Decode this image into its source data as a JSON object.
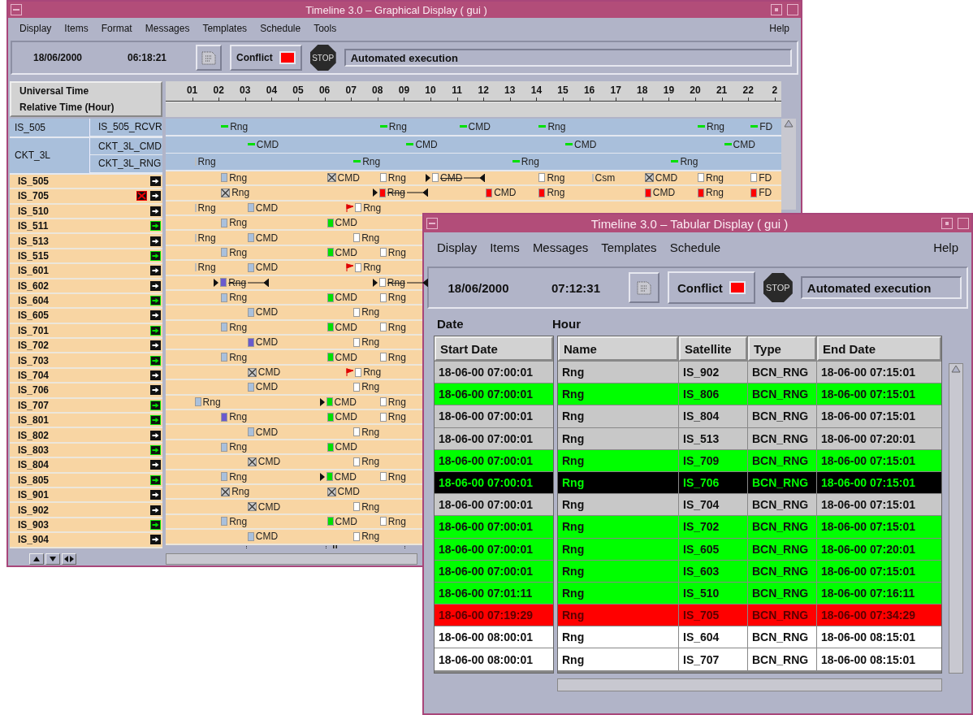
{
  "graphical": {
    "title": "Timeline 3.0 – Graphical Display ( gui )",
    "menu": [
      "Display",
      "Items",
      "Format",
      "Messages",
      "Templates",
      "Schedule",
      "Tools"
    ],
    "help": "Help",
    "date": "18/06/2000",
    "time": "06:18:21",
    "conflict_label": "Conflict",
    "conflict": true,
    "stop_label": "STOP",
    "status": "Automated execution",
    "header": [
      "Universal Time",
      "Relative Time (Hour)"
    ],
    "hours": [
      "01",
      "02",
      "03",
      "04",
      "05",
      "06",
      "07",
      "08",
      "09",
      "10",
      "11",
      "12",
      "13",
      "14",
      "15",
      "16",
      "17",
      "18",
      "19",
      "20",
      "21",
      "22",
      "2"
    ],
    "groups": [
      {
        "name": "IS_505",
        "rows": [
          {
            "name": "IS_505_RCVR",
            "items": [
              {
                "kind": "gap"
              },
              {
                "kind": "gap"
              },
              {
                "kind": "dash",
                "label": "Rng"
              },
              {
                "kind": "gap"
              },
              {
                "kind": "gap"
              },
              {
                "kind": "gap"
              },
              {
                "kind": "gap"
              },
              {
                "kind": "gap"
              },
              {
                "kind": "dash",
                "label": "Rng"
              },
              {
                "kind": "gap"
              },
              {
                "kind": "gap"
              },
              {
                "kind": "dash",
                "label": "CMD"
              },
              {
                "kind": "gap"
              },
              {
                "kind": "gap"
              },
              {
                "kind": "dash",
                "label": "Rng"
              },
              {
                "kind": "gap"
              },
              {
                "kind": "gap"
              },
              {
                "kind": "gap"
              },
              {
                "kind": "gap"
              },
              {
                "kind": "gap"
              },
              {
                "kind": "dash",
                "label": "Rng"
              },
              {
                "kind": "gap"
              },
              {
                "kind": "dash",
                "label": "FD"
              }
            ]
          }
        ]
      },
      {
        "name": "CKT_3L",
        "rows": [
          {
            "name": "CKT_3L_CMD",
            "items": [
              {
                "kind": "gap"
              },
              {
                "kind": "gap"
              },
              {
                "kind": "gap"
              },
              {
                "kind": "dash",
                "label": "CMD"
              },
              {
                "kind": "gap"
              },
              {
                "kind": "gap"
              },
              {
                "kind": "gap"
              },
              {
                "kind": "gap"
              },
              {
                "kind": "gap"
              },
              {
                "kind": "dash",
                "label": "CMD"
              },
              {
                "kind": "gap"
              },
              {
                "kind": "gap"
              },
              {
                "kind": "gap"
              },
              {
                "kind": "gap"
              },
              {
                "kind": "gap"
              },
              {
                "kind": "dash",
                "label": "CMD"
              },
              {
                "kind": "gap"
              },
              {
                "kind": "gap"
              },
              {
                "kind": "gap"
              },
              {
                "kind": "gap"
              },
              {
                "kind": "gap"
              },
              {
                "kind": "dash",
                "label": "CMD"
              }
            ]
          },
          {
            "name": "CKT_3L_RNG",
            "items": [
              {
                "kind": "gap"
              },
              {
                "kind": "tick",
                "label": "Rng"
              },
              {
                "kind": "gap"
              },
              {
                "kind": "gap"
              },
              {
                "kind": "gap"
              },
              {
                "kind": "gap"
              },
              {
                "kind": "gap"
              },
              {
                "kind": "dash",
                "label": "Rng"
              },
              {
                "kind": "gap"
              },
              {
                "kind": "gap"
              },
              {
                "kind": "gap"
              },
              {
                "kind": "gap"
              },
              {
                "kind": "gap"
              },
              {
                "kind": "dash",
                "label": "Rng"
              },
              {
                "kind": "gap"
              },
              {
                "kind": "gap"
              },
              {
                "kind": "gap"
              },
              {
                "kind": "gap"
              },
              {
                "kind": "gap"
              },
              {
                "kind": "dash",
                "label": "Rng"
              }
            ]
          }
        ]
      }
    ],
    "rows": [
      {
        "name": "IS_505",
        "active": false,
        "error": false,
        "items": [
          {
            "kind": "gap"
          },
          {
            "kind": "gap"
          },
          {
            "kind": "lightblue",
            "label": "Rng"
          },
          {
            "kind": "gap"
          },
          {
            "kind": "gap"
          },
          {
            "kind": "gap"
          },
          {
            "kind": "cross",
            "label": "CMD"
          },
          {
            "kind": "gap"
          },
          {
            "kind": "white",
            "label": "Rng"
          },
          {
            "kind": "gap"
          },
          {
            "kind": "whitebracket",
            "label": "CMD"
          },
          {
            "kind": "gap"
          },
          {
            "kind": "gap"
          },
          {
            "kind": "gap"
          },
          {
            "kind": "white",
            "label": "Rng"
          },
          {
            "kind": "gap"
          },
          {
            "kind": "tick",
            "label": "Csm"
          },
          {
            "kind": "gap"
          },
          {
            "kind": "cross",
            "label": "CMD"
          },
          {
            "kind": "gap"
          },
          {
            "kind": "white",
            "label": "Rng"
          },
          {
            "kind": "gap"
          },
          {
            "kind": "white",
            "label": "FD"
          }
        ]
      },
      {
        "name": "IS_705",
        "active": false,
        "error": true,
        "items": [
          {
            "kind": "gap"
          },
          {
            "kind": "gap"
          },
          {
            "kind": "cross",
            "label": "Rng"
          },
          {
            "kind": "gap"
          },
          {
            "kind": "gap"
          },
          {
            "kind": "gap"
          },
          {
            "kind": "gap"
          },
          {
            "kind": "gap"
          },
          {
            "kind": "redbracket",
            "label": "Rng"
          },
          {
            "kind": "gap"
          },
          {
            "kind": "gap"
          },
          {
            "kind": "gap"
          },
          {
            "kind": "red",
            "label": "CMD"
          },
          {
            "kind": "gap"
          },
          {
            "kind": "red",
            "label": "Rng"
          },
          {
            "kind": "gap"
          },
          {
            "kind": "gap"
          },
          {
            "kind": "gap"
          },
          {
            "kind": "red",
            "label": "CMD"
          },
          {
            "kind": "gap"
          },
          {
            "kind": "red",
            "label": "Rng"
          },
          {
            "kind": "gap"
          },
          {
            "kind": "red",
            "label": "FD"
          }
        ]
      },
      {
        "name": "IS_510",
        "active": false,
        "error": false,
        "items": [
          {
            "kind": "gap"
          },
          {
            "kind": "tick",
            "label": "Rng"
          },
          {
            "kind": "gap"
          },
          {
            "kind": "lightblue",
            "label": "CMD"
          },
          {
            "kind": "gap"
          },
          {
            "kind": "gap"
          },
          {
            "kind": "gap"
          },
          {
            "kind": "whiteflag",
            "label": "Rng"
          }
        ]
      },
      {
        "name": "IS_511",
        "active": true,
        "error": false,
        "items": [
          {
            "kind": "gap"
          },
          {
            "kind": "gap"
          },
          {
            "kind": "lightblue",
            "label": "Rng"
          },
          {
            "kind": "gap"
          },
          {
            "kind": "gap"
          },
          {
            "kind": "gap"
          },
          {
            "kind": "green",
            "label": "CMD"
          }
        ]
      },
      {
        "name": "IS_513",
        "active": false,
        "error": false,
        "items": [
          {
            "kind": "gap"
          },
          {
            "kind": "tick",
            "label": "Rng"
          },
          {
            "kind": "gap"
          },
          {
            "kind": "lightblue",
            "label": "CMD"
          },
          {
            "kind": "gap"
          },
          {
            "kind": "gap"
          },
          {
            "kind": "gap"
          },
          {
            "kind": "white",
            "label": "Rng"
          }
        ]
      },
      {
        "name": "IS_515",
        "active": true,
        "error": false,
        "items": [
          {
            "kind": "gap"
          },
          {
            "kind": "gap"
          },
          {
            "kind": "lightblue",
            "label": "Rng"
          },
          {
            "kind": "gap"
          },
          {
            "kind": "gap"
          },
          {
            "kind": "gap"
          },
          {
            "kind": "green",
            "label": "CMD"
          },
          {
            "kind": "gap"
          },
          {
            "kind": "white",
            "label": "Rng"
          }
        ]
      },
      {
        "name": "IS_601",
        "active": false,
        "error": false,
        "items": [
          {
            "kind": "gap"
          },
          {
            "kind": "tick",
            "label": "Rng"
          },
          {
            "kind": "gap"
          },
          {
            "kind": "lightblue",
            "label": "CMD"
          },
          {
            "kind": "gap"
          },
          {
            "kind": "gap"
          },
          {
            "kind": "gap"
          },
          {
            "kind": "whiteflag",
            "label": "Rng"
          }
        ]
      },
      {
        "name": "IS_602",
        "active": false,
        "error": false,
        "items": [
          {
            "kind": "gap"
          },
          {
            "kind": "gap"
          },
          {
            "kind": "purplebracket",
            "label": "Rng"
          },
          {
            "kind": "gap"
          },
          {
            "kind": "gap"
          },
          {
            "kind": "gap"
          },
          {
            "kind": "gap"
          },
          {
            "kind": "gap"
          },
          {
            "kind": "whitebracket",
            "label": "Rng"
          }
        ]
      },
      {
        "name": "IS_604",
        "active": true,
        "error": false,
        "items": [
          {
            "kind": "gap"
          },
          {
            "kind": "gap"
          },
          {
            "kind": "lightblue",
            "label": "Rng"
          },
          {
            "kind": "gap"
          },
          {
            "kind": "gap"
          },
          {
            "kind": "gap"
          },
          {
            "kind": "green",
            "label": "CMD"
          },
          {
            "kind": "gap"
          },
          {
            "kind": "white",
            "label": "Rng"
          }
        ]
      },
      {
        "name": "IS_605",
        "active": false,
        "error": false,
        "items": [
          {
            "kind": "gap"
          },
          {
            "kind": "gap"
          },
          {
            "kind": "gap"
          },
          {
            "kind": "lightblue",
            "label": "CMD"
          },
          {
            "kind": "gap"
          },
          {
            "kind": "gap"
          },
          {
            "kind": "gap"
          },
          {
            "kind": "white",
            "label": "Rng"
          }
        ]
      },
      {
        "name": "IS_701",
        "active": true,
        "error": false,
        "items": [
          {
            "kind": "gap"
          },
          {
            "kind": "gap"
          },
          {
            "kind": "lightblue",
            "label": "Rng"
          },
          {
            "kind": "gap"
          },
          {
            "kind": "gap"
          },
          {
            "kind": "gap"
          },
          {
            "kind": "green",
            "label": "CMD"
          },
          {
            "kind": "gap"
          },
          {
            "kind": "white",
            "label": "Rng"
          }
        ]
      },
      {
        "name": "IS_702",
        "active": false,
        "error": false,
        "items": [
          {
            "kind": "gap"
          },
          {
            "kind": "gap"
          },
          {
            "kind": "gap"
          },
          {
            "kind": "purple",
            "label": "CMD"
          },
          {
            "kind": "gap"
          },
          {
            "kind": "gap"
          },
          {
            "kind": "gap"
          },
          {
            "kind": "white",
            "label": "Rng"
          }
        ]
      },
      {
        "name": "IS_703",
        "active": true,
        "error": false,
        "items": [
          {
            "kind": "gap"
          },
          {
            "kind": "gap"
          },
          {
            "kind": "lightblue",
            "label": "Rng"
          },
          {
            "kind": "gap"
          },
          {
            "kind": "gap"
          },
          {
            "kind": "gap"
          },
          {
            "kind": "green",
            "label": "CMD"
          },
          {
            "kind": "gap"
          },
          {
            "kind": "white",
            "label": "Rng"
          }
        ]
      },
      {
        "name": "IS_704",
        "active": false,
        "error": false,
        "items": [
          {
            "kind": "gap"
          },
          {
            "kind": "gap"
          },
          {
            "kind": "gap"
          },
          {
            "kind": "cross",
            "label": "CMD"
          },
          {
            "kind": "gap"
          },
          {
            "kind": "gap"
          },
          {
            "kind": "gap"
          },
          {
            "kind": "whiteflag",
            "label": "Rng"
          }
        ]
      },
      {
        "name": "IS_706",
        "active": false,
        "error": false,
        "items": [
          {
            "kind": "gap"
          },
          {
            "kind": "gap"
          },
          {
            "kind": "gap"
          },
          {
            "kind": "lightblue",
            "label": "CMD"
          },
          {
            "kind": "gap"
          },
          {
            "kind": "gap"
          },
          {
            "kind": "gap"
          },
          {
            "kind": "white",
            "label": "Rng"
          }
        ]
      },
      {
        "name": "IS_707",
        "active": true,
        "error": false,
        "items": [
          {
            "kind": "gap"
          },
          {
            "kind": "lightblue",
            "label": "Rng"
          },
          {
            "kind": "gap"
          },
          {
            "kind": "gap"
          },
          {
            "kind": "gap"
          },
          {
            "kind": "gap"
          },
          {
            "kind": "greenarrow",
            "label": "CMD"
          },
          {
            "kind": "gap"
          },
          {
            "kind": "white",
            "label": "Rng"
          }
        ]
      },
      {
        "name": "IS_801",
        "active": true,
        "error": false,
        "items": [
          {
            "kind": "gap"
          },
          {
            "kind": "gap"
          },
          {
            "kind": "purple",
            "label": "Rng"
          },
          {
            "kind": "gap"
          },
          {
            "kind": "gap"
          },
          {
            "kind": "gap"
          },
          {
            "kind": "green",
            "label": "CMD"
          },
          {
            "kind": "gap"
          },
          {
            "kind": "white",
            "label": "Rng"
          }
        ]
      },
      {
        "name": "IS_802",
        "active": false,
        "error": false,
        "items": [
          {
            "kind": "gap"
          },
          {
            "kind": "gap"
          },
          {
            "kind": "gap"
          },
          {
            "kind": "lightblue",
            "label": "CMD"
          },
          {
            "kind": "gap"
          },
          {
            "kind": "gap"
          },
          {
            "kind": "gap"
          },
          {
            "kind": "white",
            "label": "Rng"
          }
        ]
      },
      {
        "name": "IS_803",
        "active": true,
        "error": false,
        "items": [
          {
            "kind": "gap"
          },
          {
            "kind": "gap"
          },
          {
            "kind": "lightblue",
            "label": "Rng"
          },
          {
            "kind": "gap"
          },
          {
            "kind": "gap"
          },
          {
            "kind": "gap"
          },
          {
            "kind": "green",
            "label": "CMD"
          }
        ]
      },
      {
        "name": "IS_804",
        "active": false,
        "error": false,
        "items": [
          {
            "kind": "gap"
          },
          {
            "kind": "gap"
          },
          {
            "kind": "gap"
          },
          {
            "kind": "cross",
            "label": "CMD"
          },
          {
            "kind": "gap"
          },
          {
            "kind": "gap"
          },
          {
            "kind": "gap"
          },
          {
            "kind": "white",
            "label": "Rng"
          }
        ]
      },
      {
        "name": "IS_805",
        "active": true,
        "error": false,
        "items": [
          {
            "kind": "gap"
          },
          {
            "kind": "gap"
          },
          {
            "kind": "lightblue",
            "label": "Rng"
          },
          {
            "kind": "gap"
          },
          {
            "kind": "gap"
          },
          {
            "kind": "gap"
          },
          {
            "kind": "greenarrow",
            "label": "CMD"
          },
          {
            "kind": "gap"
          },
          {
            "kind": "white",
            "label": "Rng"
          }
        ]
      },
      {
        "name": "IS_901",
        "active": false,
        "error": false,
        "items": [
          {
            "kind": "gap"
          },
          {
            "kind": "gap"
          },
          {
            "kind": "cross",
            "label": "Rng"
          },
          {
            "kind": "gap"
          },
          {
            "kind": "gap"
          },
          {
            "kind": "gap"
          },
          {
            "kind": "cross",
            "label": "CMD"
          }
        ]
      },
      {
        "name": "IS_902",
        "active": false,
        "error": false,
        "items": [
          {
            "kind": "gap"
          },
          {
            "kind": "gap"
          },
          {
            "kind": "gap"
          },
          {
            "kind": "cross",
            "label": "CMD"
          },
          {
            "kind": "gap"
          },
          {
            "kind": "gap"
          },
          {
            "kind": "gap"
          },
          {
            "kind": "white",
            "label": "Rng"
          }
        ]
      },
      {
        "name": "IS_903",
        "active": true,
        "error": false,
        "items": [
          {
            "kind": "gap"
          },
          {
            "kind": "gap"
          },
          {
            "kind": "lightblue",
            "label": "Rng"
          },
          {
            "kind": "gap"
          },
          {
            "kind": "gap"
          },
          {
            "kind": "gap"
          },
          {
            "kind": "green",
            "label": "CMD"
          },
          {
            "kind": "gap"
          },
          {
            "kind": "white",
            "label": "Rng"
          }
        ]
      },
      {
        "name": "IS_904",
        "active": false,
        "error": false,
        "items": [
          {
            "kind": "gap"
          },
          {
            "kind": "gap"
          },
          {
            "kind": "gap"
          },
          {
            "kind": "lightblue",
            "label": "CMD"
          },
          {
            "kind": "gap"
          },
          {
            "kind": "gap"
          },
          {
            "kind": "gap"
          },
          {
            "kind": "white",
            "label": "Rng"
          }
        ]
      }
    ]
  },
  "tabular": {
    "title": "Timeline 3.0 – Tabular Display ( gui )",
    "menu": [
      "Display",
      "Items",
      "Messages",
      "Templates",
      "Schedule"
    ],
    "help": "Help",
    "date": "18/06/2000",
    "time": "07:12:31",
    "conflict_label": "Conflict",
    "conflict": true,
    "stop_label": "STOP",
    "status": "Automated execution",
    "date_label": "Date",
    "hour_label": "Hour",
    "columns": [
      "Start Date",
      "Name",
      "Satellite",
      "Type",
      "End Date"
    ],
    "rows": [
      {
        "start": "18-06-00 07:00:01",
        "name": "Rng",
        "satellite": "IS_902",
        "type": "BCN_RNG",
        "end": "18-06-00 07:15:01",
        "color": "#c8c8c8",
        "selected": false
      },
      {
        "start": "18-06-00 07:00:01",
        "name": "Rng",
        "satellite": "IS_806",
        "type": "BCN_RNG",
        "end": "18-06-00 07:15:01",
        "color": "#00ff00",
        "selected": false
      },
      {
        "start": "18-06-00 07:00:01",
        "name": "Rng",
        "satellite": "IS_804",
        "type": "BCN_RNG",
        "end": "18-06-00 07:15:01",
        "color": "#c8c8c8",
        "selected": false
      },
      {
        "start": "18-06-00 07:00:01",
        "name": "Rng",
        "satellite": "IS_513",
        "type": "BCN_RNG",
        "end": "18-06-00 07:20:01",
        "color": "#c8c8c8",
        "selected": false
      },
      {
        "start": "18-06-00 07:00:01",
        "name": "Rng",
        "satellite": "IS_709",
        "type": "BCN_RNG",
        "end": "18-06-00 07:15:01",
        "color": "#00ff00",
        "selected": false
      },
      {
        "start": "18-06-00 07:00:01",
        "name": "Rng",
        "satellite": "IS_706",
        "type": "BCN_RNG",
        "end": "18-06-00 07:15:01",
        "color": "#000000",
        "selected": true
      },
      {
        "start": "18-06-00 07:00:01",
        "name": "Rng",
        "satellite": "IS_704",
        "type": "BCN_RNG",
        "end": "18-06-00 07:15:01",
        "color": "#c8c8c8",
        "selected": false
      },
      {
        "start": "18-06-00 07:00:01",
        "name": "Rng",
        "satellite": "IS_702",
        "type": "BCN_RNG",
        "end": "18-06-00 07:15:01",
        "color": "#00ff00",
        "selected": false
      },
      {
        "start": "18-06-00 07:00:01",
        "name": "Rng",
        "satellite": "IS_605",
        "type": "BCN_RNG",
        "end": "18-06-00 07:20:01",
        "color": "#00ff00",
        "selected": false
      },
      {
        "start": "18-06-00 07:00:01",
        "name": "Rng",
        "satellite": "IS_603",
        "type": "BCN_RNG",
        "end": "18-06-00 07:15:01",
        "color": "#00ff00",
        "selected": false
      },
      {
        "start": "18-06-00 07:01:11",
        "name": "Rng",
        "satellite": "IS_510",
        "type": "BCN_RNG",
        "end": "18-06-00 07:16:11",
        "color": "#00ff00",
        "selected": false
      },
      {
        "start": "18-06-00 07:19:29",
        "name": "Rng",
        "satellite": "IS_705",
        "type": "BCN_RNG",
        "end": "18-06-00 07:34:29",
        "color": "#ff0000",
        "selected": false
      },
      {
        "start": "18-06-00 08:00:01",
        "name": "Rng",
        "satellite": "IS_604",
        "type": "BCN_RNG",
        "end": "18-06-00 08:15:01",
        "color": "#ffffff",
        "selected": false
      },
      {
        "start": "18-06-00 08:00:01",
        "name": "Rng",
        "satellite": "IS_707",
        "type": "BCN_RNG",
        "end": "18-06-00 08:15:01",
        "color": "#ffffff",
        "selected": false
      }
    ]
  }
}
